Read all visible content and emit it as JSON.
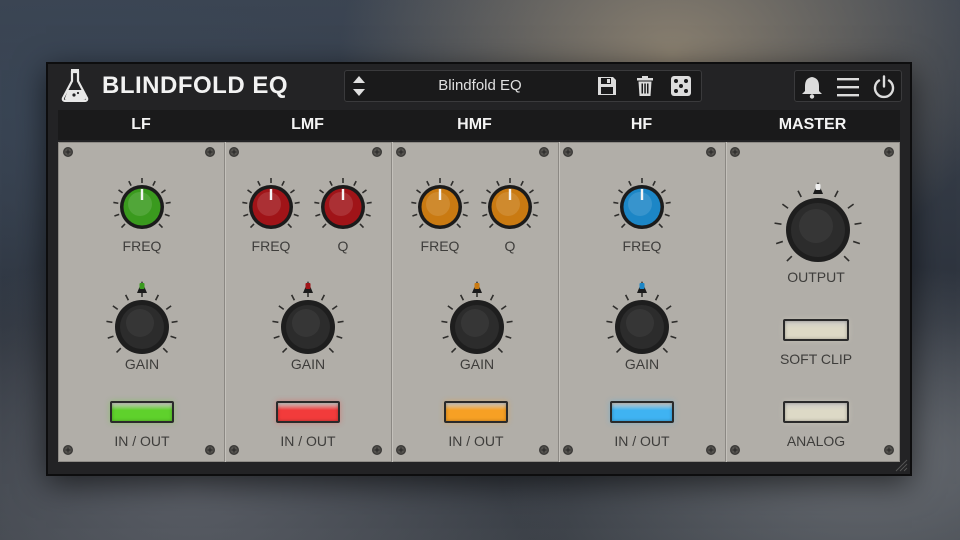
{
  "header": {
    "title": "BLINDFOLD EQ",
    "preset_name": "Blindfold EQ",
    "icons": [
      "preset-arrows-icon",
      "save-icon",
      "trash-icon",
      "dice-icon",
      "bell-icon",
      "menu-icon",
      "power-icon"
    ]
  },
  "sections": {
    "lf": {
      "name": "LF",
      "accent": "#3a9a1e",
      "freq_label": "FREQ",
      "gain_label": "GAIN",
      "button_label": "IN / OUT",
      "button_color": "#5fd12c"
    },
    "lmf": {
      "name": "LMF",
      "accent": "#a01418",
      "freq_label": "FREQ",
      "q_label": "Q",
      "gain_label": "GAIN",
      "button_label": "IN / OUT",
      "button_color": "#f23b3b"
    },
    "hmf": {
      "name": "HMF",
      "accent": "#c97a12",
      "freq_label": "FREQ",
      "q_label": "Q",
      "gain_label": "GAIN",
      "button_label": "IN / OUT",
      "button_color": "#f7a024"
    },
    "hf": {
      "name": "HF",
      "accent": "#1c86c6",
      "freq_label": "FREQ",
      "gain_label": "GAIN",
      "button_label": "IN / OUT",
      "button_color": "#3fb3f2"
    },
    "master": {
      "name": "MASTER",
      "output_label": "OUTPUT",
      "soft_clip_label": "SOFT CLIP",
      "analog_label": "ANALOG",
      "button_color": "#ddd9c6"
    }
  }
}
